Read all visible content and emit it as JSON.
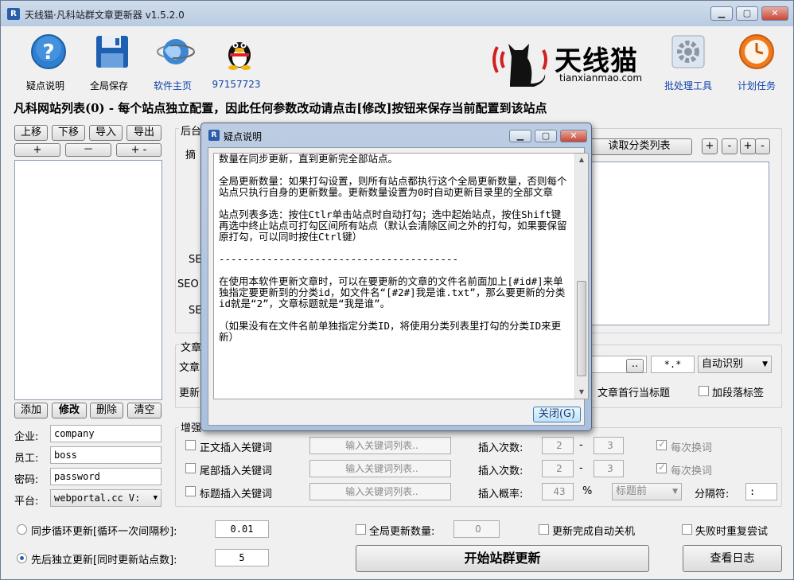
{
  "window": {
    "title": "天线猫·凡科站群文章更新器 v1.5.2.0",
    "app_icon": "R"
  },
  "toolbar": {
    "help": "疑点说明",
    "save_all": "全局保存",
    "homepage": "软件主页",
    "qq": "97157723",
    "batch_tool": "批处理工具",
    "scheduled": "计划任务"
  },
  "brand": {
    "name": "天线猫",
    "url": "tianxianmao.com"
  },
  "heading": "凡科网站列表(0) - 每个站点独立配置，因此任何参数改动请点击[修改]按钮来保存当前配置到该站点",
  "site_list": {
    "move_up": "上移",
    "move_down": "下移",
    "import": "导入",
    "export": "导出",
    "plus": "+",
    "minus": "－",
    "plus_minus": "+ -",
    "add": "添加",
    "edit": "修改",
    "delete": "删除",
    "clear": "清空"
  },
  "account": {
    "company_label": "企业:",
    "company_value": "company",
    "staff_label": "员工:",
    "staff_value": "boss",
    "password_label": "密码:",
    "password_value": "password",
    "platform_label": "平台:",
    "platform_value": "webportal.cc V:"
  },
  "right_panel": {
    "backend_label": "后台",
    "summary_label": "摘",
    "seo_label_1": "SE",
    "seo_label_2": "SEO",
    "seo_label_3": "SE",
    "fetch_categories": "读取分类列表",
    "btn_plus": "+",
    "btn_minus": "-",
    "btn_plus2": "+",
    "btn_minus2": "-",
    "article_group": "文章",
    "article_label": "文章",
    "update_label": "更新",
    "browse": "..",
    "ext": "*.*",
    "encoding": "自动识别",
    "first_line_title": "文章首行当标题",
    "add_paragraph_tags": "加段落标签"
  },
  "enhance": {
    "group_label": "增强",
    "rows": [
      {
        "label": "正文插入关键词",
        "input": "输入关键词列表..",
        "count_label": "插入次数:",
        "from": "2",
        "to": "3",
        "each": "每次换词"
      },
      {
        "label": "尾部插入关键词",
        "input": "输入关键词列表..",
        "count_label": "插入次数:",
        "from": "2",
        "to": "3",
        "each": "每次换词"
      }
    ],
    "title_row": {
      "label": "标题插入关键词",
      "input": "输入关键词列表..",
      "prob_label": "插入概率:",
      "prob": "43",
      "pct": "%",
      "position": "标题前",
      "sep_label": "分隔符:",
      "sep": ":"
    },
    "dash": "-"
  },
  "bottom": {
    "sync_loop": "同步循环更新[循环一次间隔秒]:",
    "sync_value": "0.01",
    "independent": "先后独立更新[同时更新站点数]:",
    "independent_value": "5",
    "global_count": "全局更新数量:",
    "global_value": "0",
    "auto_shutdown": "更新完成自动关机",
    "retry": "失败时重复尝试",
    "start": "开始站群更新",
    "view_log": "查看日志"
  },
  "dialog": {
    "title": "疑点说明",
    "text": "数量在同步更新，直到更新完全部站点。\n\n全局更新数量：如果打勾设置，则所有站点都执行这个全局更新数量，否则每个站点只执行自身的更新数量。更新数量设置为0时自动更新目录里的全部文章\n\n站点列表多选：按住Ctlr单击站点时自动打勾；选中起始站点，按住Shift键再选中终止站点可打勾区间所有站点（默认会清除区间之外的打勾，如果要保留原打勾，可以同时按住Ctrl键）\n\n----------------------------------------\n\n在使用本软件更新文章时，可以在要更新的文章的文件名前面加上[#id#]来单独指定要更新到的分类id，如文件名“[#2#]我是谁.txt”，那么要更新的分类id就是“2”，文章标题就是“我是谁”。\n\n（如果没有在文件名前单独指定分类ID，将使用分类列表里打勾的分类ID来更新）",
    "close": "关闭(G)"
  },
  "icons": [
    "help-icon",
    "save-icon",
    "globe-icon",
    "qq-penguin-icon",
    "settings-icon",
    "clock-icon",
    "cat-logo-icon"
  ]
}
